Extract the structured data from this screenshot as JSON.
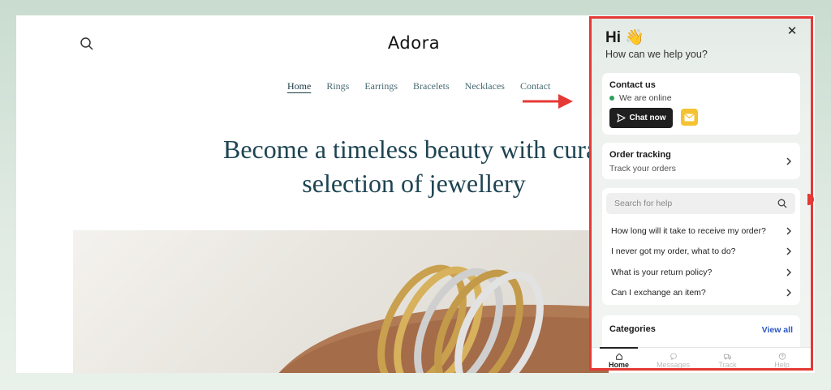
{
  "store": {
    "logo": "Adora",
    "nav": [
      "Home",
      "Rings",
      "Earrings",
      "Bracelets",
      "Necklaces",
      "Contact"
    ],
    "active_nav": "Home",
    "hero_line1": "Become a timeless beauty with curat",
    "hero_line2": "selection of jewellery"
  },
  "widget": {
    "greeting": "Hi 👋",
    "subtitle": "How can we help you?",
    "contact": {
      "title": "Contact us",
      "status": "We are online",
      "chat_button": "Chat now"
    },
    "tracking": {
      "title": "Order tracking",
      "subtitle": "Track your orders"
    },
    "search_placeholder": "Search for help",
    "faqs": [
      "How long will it take to receive my order?",
      "I never got my order, what to do?",
      "What is your return policy?",
      "Can I exchange an item?"
    ],
    "categories": {
      "title": "Categories",
      "view_all": "View all"
    },
    "tabs": [
      "Home",
      "Messages",
      "Track",
      "Help"
    ]
  },
  "colors": {
    "annotation_red": "#e53935",
    "online_green": "#2e9e5b",
    "mail_yellow": "#f5c331",
    "link_blue": "#2a56c6",
    "nav_teal": "#486b72"
  },
  "icons": [
    "search-icon",
    "close-icon",
    "send-icon",
    "mail-icon",
    "chevron-right-icon",
    "home-icon",
    "chat-bubble-icon",
    "truck-icon",
    "help-circle-icon"
  ]
}
